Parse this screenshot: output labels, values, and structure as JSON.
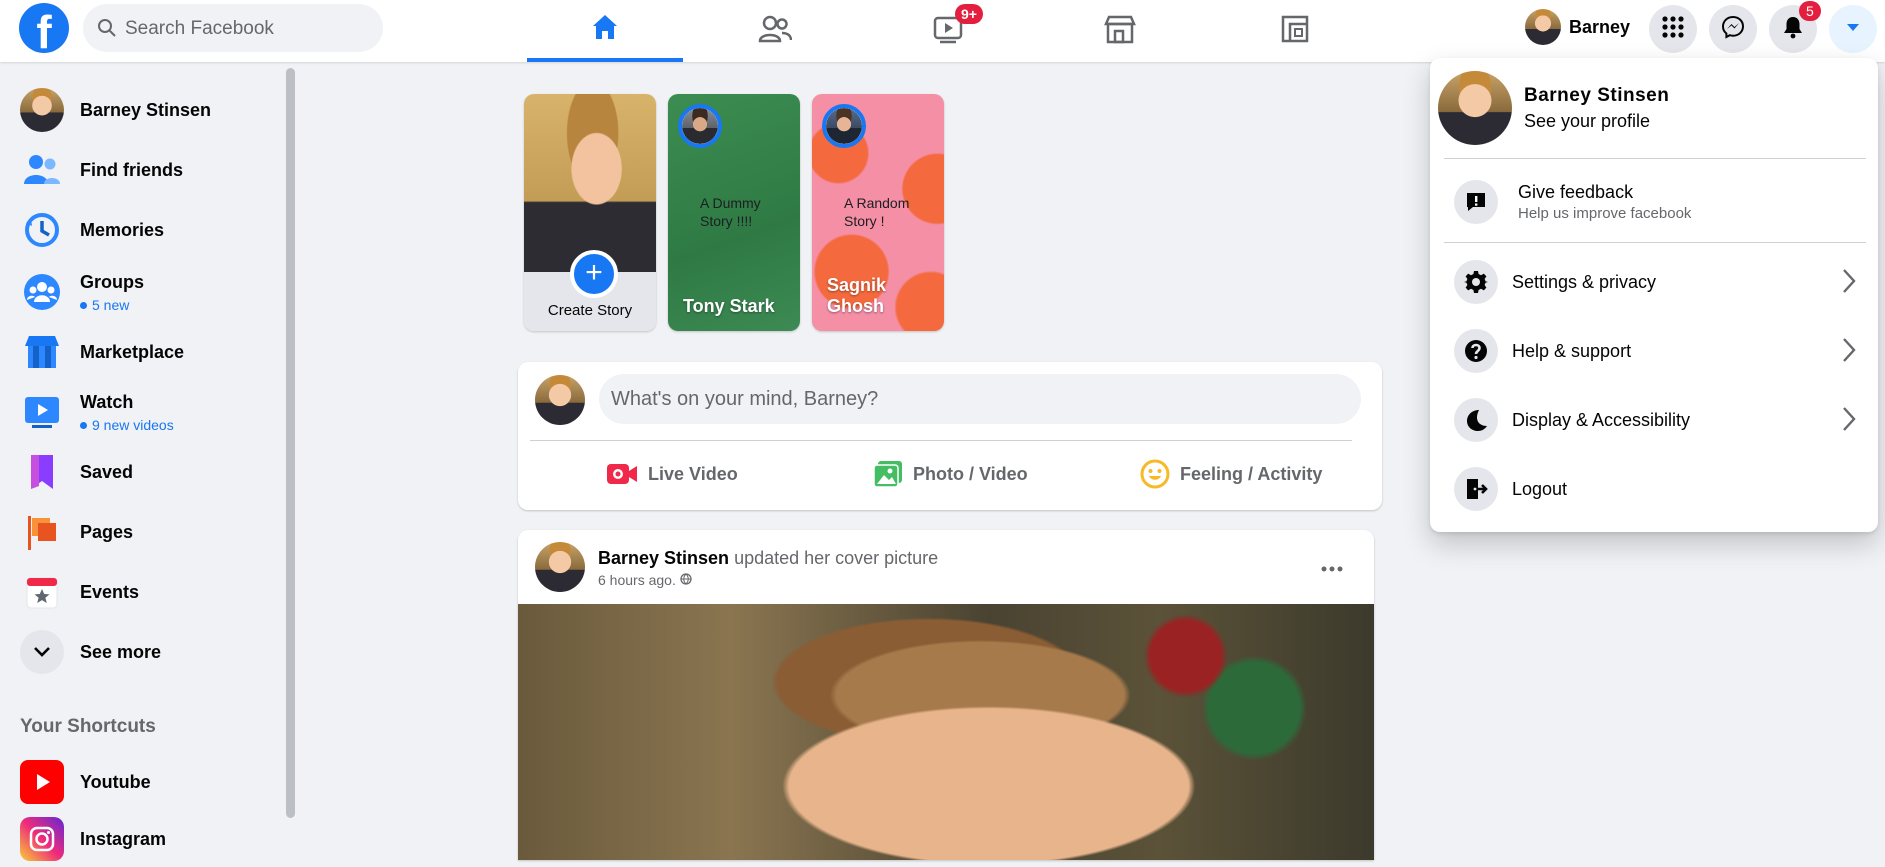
{
  "topbar": {
    "logo_letter": "f",
    "search_placeholder": "Search Facebook",
    "nav_tabs": [
      {
        "name": "home",
        "icon": "home-icon",
        "active": true
      },
      {
        "name": "friends",
        "icon": "friends-icon",
        "active": false
      },
      {
        "name": "watch",
        "icon": "watch-icon",
        "active": false,
        "badge": "9+"
      },
      {
        "name": "marketplace",
        "icon": "marketplace-icon",
        "active": false
      },
      {
        "name": "gaming",
        "icon": "gaming-icon",
        "active": false
      }
    ],
    "profile_name": "Barney",
    "notifications_badge": "5"
  },
  "sidebar": {
    "items": [
      {
        "label": "Barney Stinsen",
        "icon": "avatar"
      },
      {
        "label": "Find friends",
        "icon": "friends-icon"
      },
      {
        "label": "Memories",
        "icon": "clock-icon"
      },
      {
        "label": "Groups",
        "icon": "groups-icon",
        "sub": "5 new"
      },
      {
        "label": "Marketplace",
        "icon": "shop-icon"
      },
      {
        "label": "Watch",
        "icon": "watch-icon",
        "sub": "9 new videos"
      },
      {
        "label": "Saved",
        "icon": "bookmark-icon"
      },
      {
        "label": "Pages",
        "icon": "flag-icon"
      },
      {
        "label": "Events",
        "icon": "calendar-icon"
      },
      {
        "label": "See more",
        "icon": "chevron-down-icon"
      }
    ],
    "shortcuts_title": "Your Shortcuts",
    "shortcuts": [
      {
        "label": "Youtube",
        "icon": "youtube-icon"
      },
      {
        "label": "Instagram",
        "icon": "instagram-icon"
      }
    ]
  },
  "stories": {
    "create_label": "Create Story",
    "items": [
      {
        "owner": "Tony Stark",
        "text": "A Dummy Story !!!!"
      },
      {
        "owner": "Sagnik Ghosh",
        "text": "A Random Story !"
      }
    ]
  },
  "composer": {
    "placeholder": "What's on your mind, Barney?",
    "actions": [
      "Live Video",
      "Photo / Video",
      "Feeling / Activity"
    ]
  },
  "post": {
    "author": "Barney Stinsen",
    "action": "updated her cover picture",
    "time": "6 hours ago."
  },
  "menu": {
    "profile_name": "Barney Stinsen",
    "profile_sub": "See your profile",
    "feedback_label": "Give feedback",
    "feedback_sub": "Help us improve facebook",
    "items": [
      {
        "label": "Settings & privacy",
        "icon": "gear-icon",
        "arrow": true
      },
      {
        "label": "Help & support",
        "icon": "question-icon",
        "arrow": true
      },
      {
        "label": "Display & Accessibility",
        "icon": "moon-icon",
        "arrow": true
      },
      {
        "label": "Logout",
        "icon": "logout-icon",
        "arrow": false
      }
    ]
  },
  "colors": {
    "brand": "#1877f2",
    "badge": "#e41e3f",
    "background": "#f0f2f5"
  }
}
